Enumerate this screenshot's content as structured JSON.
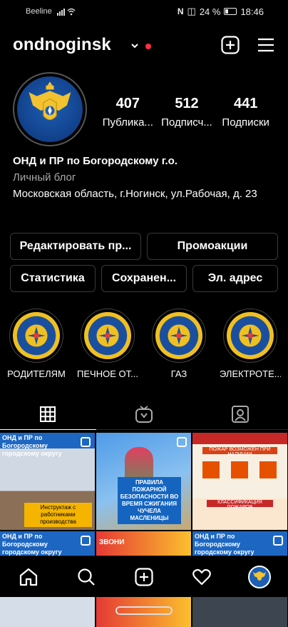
{
  "status_bar": {
    "carrier": "Beeline",
    "battery_percent": "24 %",
    "time": "18:46"
  },
  "header": {
    "username": "ondnoginsk"
  },
  "profile": {
    "stats": [
      {
        "value": "407",
        "label": "Публика..."
      },
      {
        "value": "512",
        "label": "Подписч..."
      },
      {
        "value": "441",
        "label": "Подписки"
      }
    ],
    "name": "ОНД и ПР по Богородскому г.о.",
    "category": "Личный блог",
    "address": "Московская область, г.Ногинск, ул.Рабочая, д. 23"
  },
  "buttons": {
    "edit": "Редактировать пр...",
    "promo": "Промоакции",
    "stats": "Статистика",
    "saved": "Сохранен...",
    "email": "Эл. адрес"
  },
  "highlights": [
    {
      "label": "РОДИТЕЛЯМ"
    },
    {
      "label": "ПЕЧНОЕ ОТ..."
    },
    {
      "label": "ГАЗ"
    },
    {
      "label": "ЭЛЕКТРОТЕ..."
    }
  ],
  "grid": {
    "post1_title": "ОНД и ПР по Богородскому городскому округу",
    "post1_caption": "Инструктаж с работниками производства",
    "post2_caption": "ПРАВИЛА ПОЖАРНОЙ БЕЗОПАСНОСТИ ВО ВРЕМЯ СЖИГАНИЯ ЧУЧЕЛА МАСЛЕНИЦЫ",
    "post3_header": "ПОЖАР ВОЗМОЖЕН ПРИ НАЛИЧИИ",
    "post3_footer": "КЛАССИФИКАЦИЯ ПОЖАРОВ",
    "post4_title": "ОНД и ПР по Богородскому городскому округу",
    "post5_title": "ЗВОНИ",
    "post6_title": "ОНД и ПР по Богородскому городскому округу"
  }
}
